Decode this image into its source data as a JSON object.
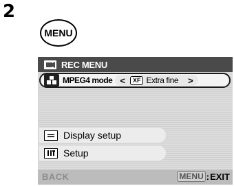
{
  "step": "2",
  "menu_button": {
    "label": "MENU"
  },
  "header": {
    "icon": "camera-icon",
    "title": "REC MENU"
  },
  "mode_row": {
    "icon": "grid-icon",
    "label": "MPEG4 mode",
    "prev": "<",
    "badge": "XF",
    "value": "Extra fine",
    "next": ">"
  },
  "items": [
    {
      "icon": "display-icon",
      "label": "Display setup"
    },
    {
      "icon": "setup-icon",
      "label": "Setup"
    }
  ],
  "footer": {
    "back_label": "BACK",
    "menu_key": "MENU",
    "separator": ":",
    "exit_label": "EXIT"
  }
}
